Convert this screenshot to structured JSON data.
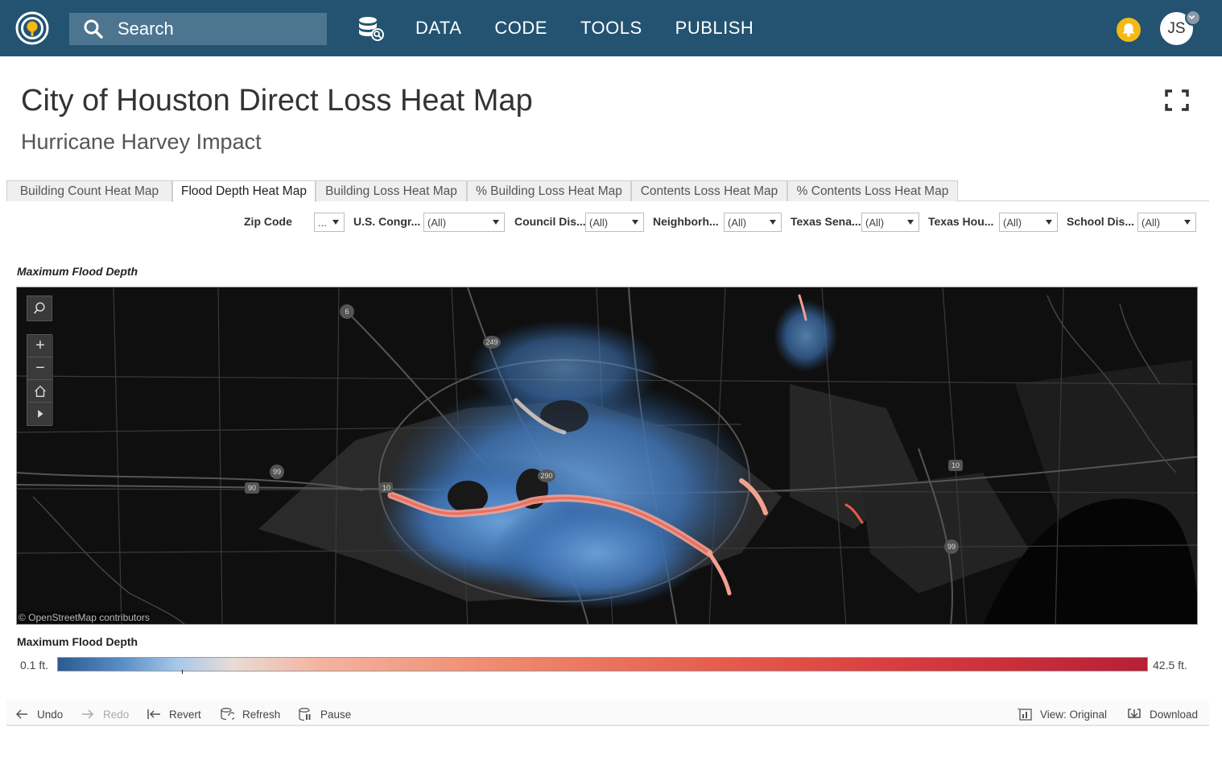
{
  "nav": {
    "search_placeholder": "Search",
    "items": [
      "DATA",
      "CODE",
      "TOOLS",
      "PUBLISH"
    ],
    "user_initials": "JS"
  },
  "page": {
    "title": "City of Houston Direct Loss Heat Map",
    "subtitle": "Hurricane Harvey Impact"
  },
  "tabs": [
    {
      "label": "Building Count Heat Map",
      "active": false
    },
    {
      "label": "Flood Depth Heat Map",
      "active": true
    },
    {
      "label": "Building Loss Heat Map",
      "active": false
    },
    {
      "label": "% Building Loss Heat Map",
      "active": false
    },
    {
      "label": "Contents Loss Heat Map",
      "active": false
    },
    {
      "label": "% Contents Loss Heat Map",
      "active": false
    }
  ],
  "filters": [
    {
      "label": "Zip Code",
      "value": "..."
    },
    {
      "label": "U.S. Congr...",
      "value": "(All)"
    },
    {
      "label": "Council Dis...",
      "value": "(All)"
    },
    {
      "label": "Neighborh...",
      "value": "(All)"
    },
    {
      "label": "Texas Sena...",
      "value": "(All)"
    },
    {
      "label": "Texas Hou...",
      "value": "(All)"
    },
    {
      "label": "School Dis...",
      "value": "(All)"
    }
  ],
  "map": {
    "title": "Maximum Flood Depth",
    "attribution": "© OpenStreetMap contributors",
    "road_shields": [
      "6",
      "249",
      "99",
      "90",
      "10",
      "290",
      "10",
      "99"
    ]
  },
  "legend": {
    "title": "Maximum Flood Depth",
    "min_label": "0.1 ft.",
    "max_label": "42.5 ft."
  },
  "toolbar": {
    "undo": "Undo",
    "redo": "Redo",
    "revert": "Revert",
    "refresh": "Refresh",
    "pause": "Pause",
    "view": "View: Original",
    "download": "Download"
  },
  "colors": {
    "header_bg": "#235371",
    "search_bg": "#4d7590",
    "bell": "#f5b914",
    "depth_low": "#2b5a90",
    "depth_high": "#b71f36"
  }
}
